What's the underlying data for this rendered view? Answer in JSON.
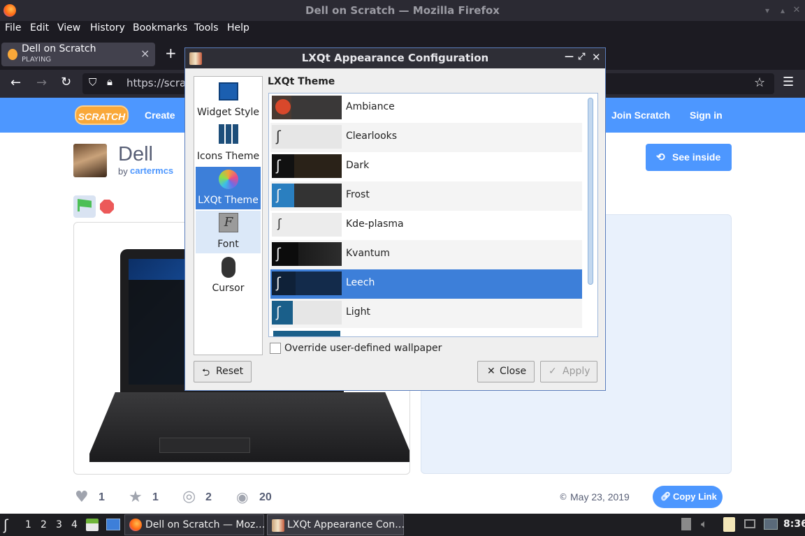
{
  "firefox": {
    "window_title": "Dell on Scratch — Mozilla Firefox",
    "menu": [
      "File",
      "Edit",
      "View",
      "History",
      "Bookmarks",
      "Tools",
      "Help"
    ],
    "tab": {
      "title": "Dell on Scratch",
      "status": "PLAYING",
      "close": "×"
    },
    "new_tab": "+",
    "url": "https://scrat"
  },
  "scratch": {
    "logo": "SCRATCH",
    "nav": {
      "create": "Create",
      "join": "Join Scratch",
      "signin": "Sign in"
    },
    "project_title": "Dell",
    "by_label": "by",
    "author": "cartermcs",
    "see_inside": "See inside",
    "stats": {
      "loves": "1",
      "favorites": "1",
      "remixes": "2",
      "views": "20"
    },
    "date": "May 23, 2019",
    "copy_link": "Copy Link"
  },
  "dialog": {
    "title": "LXQt Appearance Configuration",
    "sidebar": [
      {
        "label": "Widget Style",
        "icon": "widget-style-icon"
      },
      {
        "label": "Icons Theme",
        "icon": "icons-theme-icon"
      },
      {
        "label": "LXQt Theme",
        "icon": "lxqt-theme-icon"
      },
      {
        "label": "Font",
        "icon": "font-icon"
      },
      {
        "label": "Cursor",
        "icon": "cursor-icon"
      }
    ],
    "section_title": "LXQt Theme",
    "themes": [
      {
        "name": "Ambiance",
        "selected": false
      },
      {
        "name": "Clearlooks",
        "selected": false
      },
      {
        "name": "Dark",
        "selected": false
      },
      {
        "name": "Frost",
        "selected": false
      },
      {
        "name": "Kde-plasma",
        "selected": false
      },
      {
        "name": "Kvantum",
        "selected": false
      },
      {
        "name": "Leech",
        "selected": true
      },
      {
        "name": "Light",
        "selected": false
      }
    ],
    "override_label": "Override user-defined wallpaper",
    "reset": "Reset",
    "close": "Close",
    "apply": "Apply"
  },
  "taskbar": {
    "desktops": [
      "1",
      "2",
      "3",
      "4"
    ],
    "tasks": [
      "Dell on Scratch — Moz…",
      "LXQt Appearance Con…"
    ],
    "clock": "8:36"
  },
  "colors": {
    "accent": "#3d7fd9",
    "scratch_blue": "#4d97ff",
    "titlebar": "#2b2a33"
  }
}
